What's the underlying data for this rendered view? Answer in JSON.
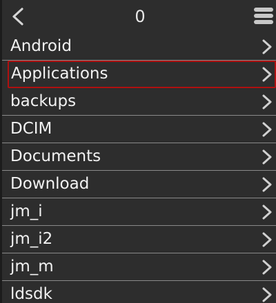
{
  "header": {
    "title": "0",
    "back_icon": "chevron-left-icon",
    "menu_icon": "hamburger-menu-icon"
  },
  "folders": [
    {
      "label": "Android"
    },
    {
      "label": "Applications",
      "selected": true
    },
    {
      "label": "backups"
    },
    {
      "label": "DCIM"
    },
    {
      "label": "Documents"
    },
    {
      "label": "Download"
    },
    {
      "label": "jm_i"
    },
    {
      "label": "jm_i2"
    },
    {
      "label": "jm_m"
    },
    {
      "label": "ldsdk"
    }
  ],
  "colors": {
    "background": "#2d2d2d",
    "text": "#f2f2f2",
    "divider": "#8a8a8a",
    "selection_border": "#b01010",
    "icon": "#d0d0d0"
  }
}
